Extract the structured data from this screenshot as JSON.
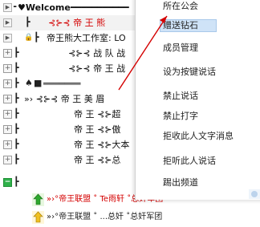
{
  "tree": {
    "rows": [
      {
        "text": "♥Welcome━━━━━━━━━━━",
        "cls": ""
      },
      {
        "text": "⊰⊱⊰ 帝 王 熊",
        "cls": "red"
      },
      {
        "text": "帝王熊大工作室: LO",
        "cls": ""
      },
      {
        "text": "⊰⊱⊰ 战 队 战",
        "cls": ""
      },
      {
        "text": "⊰⊱⊰ 帝 王 战",
        "cls": ""
      },
      {
        "text": "═══════",
        "cls": ""
      },
      {
        "text": "»› ⊰⊱⊰ 帝 王 美 眉 ",
        "cls": ""
      },
      {
        "text": "帝 王 ⊰⊱超",
        "cls": ""
      },
      {
        "text": "帝 王 ⊰⊱傲",
        "cls": ""
      },
      {
        "text": "帝 王 ⊰⊱大本",
        "cls": ""
      },
      {
        "text": "帝 王 ⊰⊱总",
        "cls": ""
      }
    ],
    "users": [
      {
        "name": "»›°帝王联盟 ˚ Te雨轩 ˚总奸军团",
        "style": "red"
      },
      {
        "name": "»›°帝王联盟 ˚ ...总奸 ˚总奸军团",
        "style": "dark"
      }
    ]
  },
  "menu": {
    "items": [
      "所在公会",
      "赠送钻石",
      "成员管理",
      "设为按键说话",
      "禁止说话",
      "禁止打字",
      "拒收此人文字消息",
      "拒听此人说话",
      "踢出频道"
    ],
    "highlighted": "赠送钻石"
  },
  "annotation_color": "#d40000"
}
